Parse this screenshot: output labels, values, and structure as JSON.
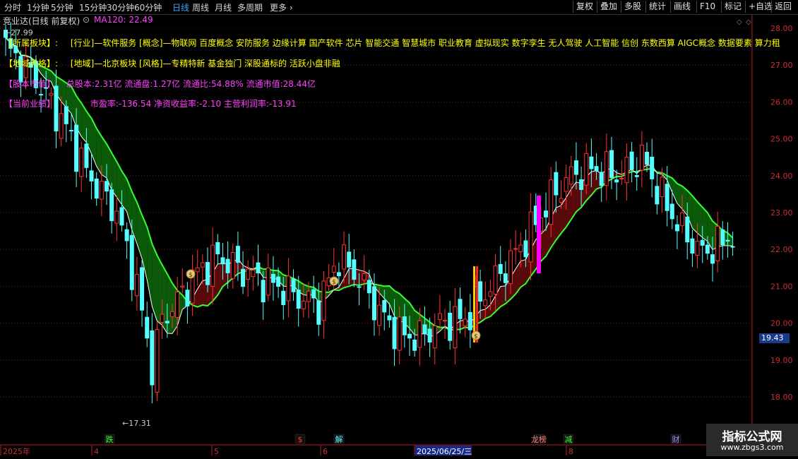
{
  "toolbar": {
    "timeframes": [
      "分时",
      "1分钟",
      "5分钟",
      "15分钟",
      "30分钟",
      "60分钟",
      "日线",
      "周线",
      "月线",
      "多周期",
      "更多"
    ],
    "active": "日线",
    "right_buttons": [
      "复权",
      "叠加",
      "多股",
      "统计",
      "画线",
      "F10",
      "标记",
      "+自选",
      "返回"
    ]
  },
  "title": {
    "stock": "竞业达(日线 前复权)",
    "ma_label": "MA120: 22.49"
  },
  "info": {
    "line1_label": "【所属板块】:",
    "line1": "[行业]—软件服务 [概念]—物联网 百度概念 安防服务 边缘计算 国产软件 芯片 智能交通 智慧城市 职业教育 虚拟现实 数字孪生 无人驾驶 人工智能 信创 东数西算 AIGC概念 数据要素 算力租",
    "line2_label": "【地域风格】:",
    "line2": "[地域]—北京板块 [风格]—专精特新 基金独门 深股通标的 活跃小盘非融",
    "line3_label": "【股本市值】",
    "line3": "总股本:2.31亿 流通盘:1.27亿 流通比:54.88% 流通市值:28.44亿",
    "line4_label": "【当前业绩】",
    "line4": "市盈率:-136.54 净资收益率:-2.10 主营利润率:-13.91"
  },
  "y_axis": [
    "28.00",
    "27.00",
    "26.00",
    "25.00",
    "24.00",
    "23.00",
    "22.00",
    "21.00",
    "20.00",
    "19.00",
    "18.00"
  ],
  "current_price": "19.43",
  "annotations": {
    "high": "27.99",
    "low": "17.31"
  },
  "x_axis": {
    "labels": [
      "2025年",
      "4",
      "5",
      "6",
      "2025/06/25/三",
      "8"
    ],
    "selected": "2025/06/25/三"
  },
  "events": [
    "跌",
    "$",
    "解",
    "龙榜",
    "减",
    "财"
  ],
  "badge": {
    "title": "指标公式网",
    "url": "www.zbgs3.com"
  },
  "colors": {
    "up": "#ff3232",
    "down": "#54ffff",
    "ma_fast": "#ffffff",
    "ma_slow": "#32ff32",
    "band_bear": "#0a5a0a",
    "band_bull": "#5a0a0a",
    "info_yellow": "#ffff00",
    "info_magenta": "#ff40ff"
  }
}
